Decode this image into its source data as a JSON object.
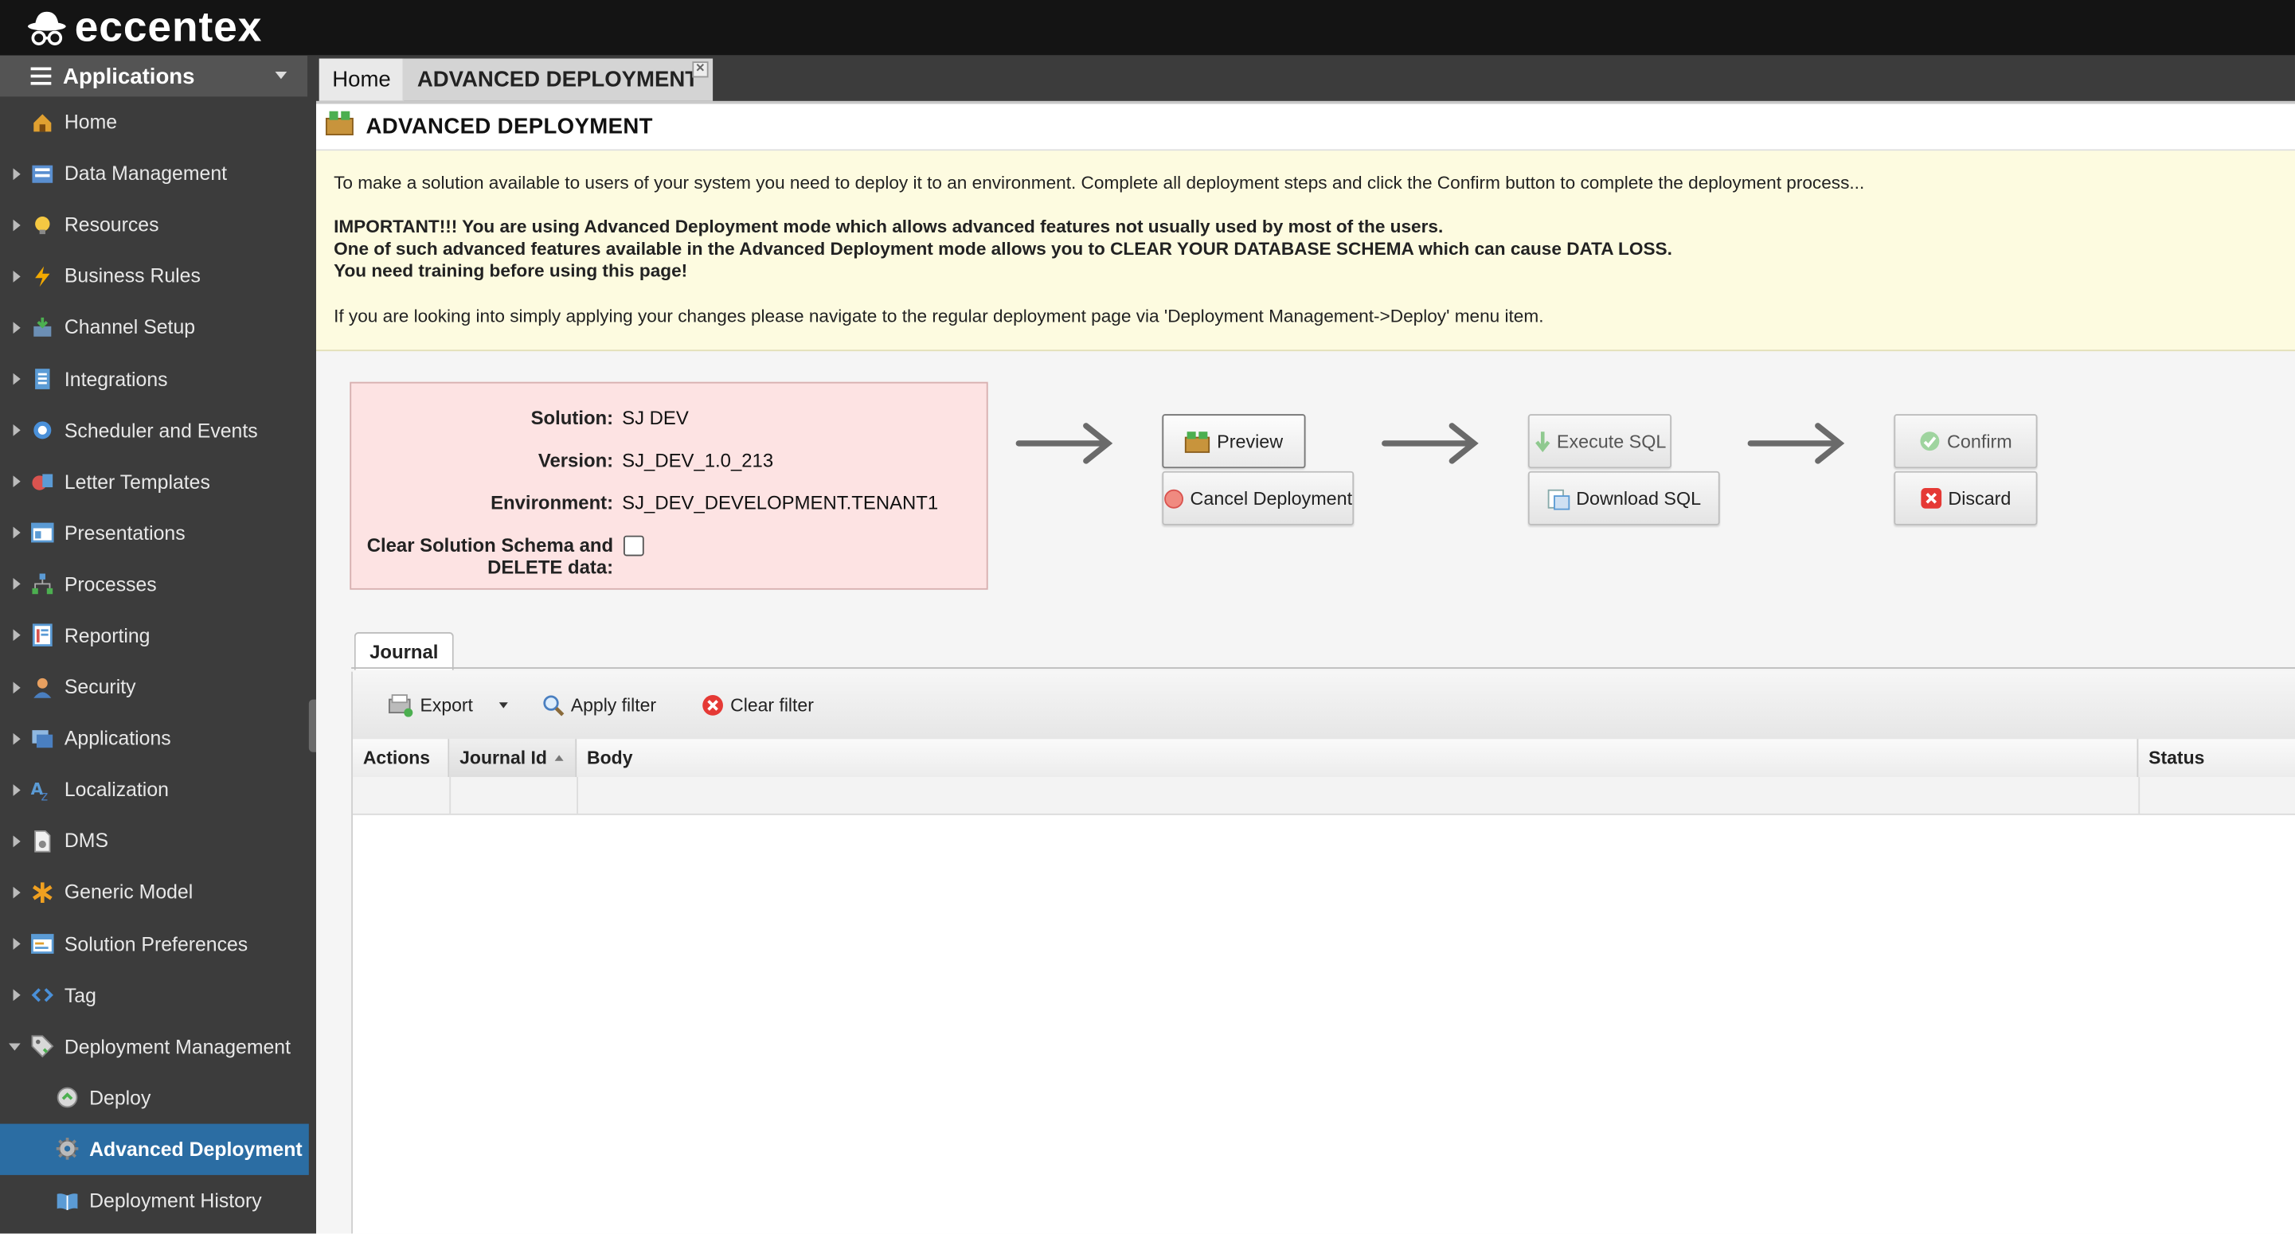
{
  "brand": {
    "name": "eccentex"
  },
  "sidebar": {
    "header_label": "Applications",
    "items": [
      {
        "label": "Home",
        "icon": "home-icon",
        "expandable": false
      },
      {
        "label": "Data Management",
        "icon": "data-management-icon",
        "expandable": true
      },
      {
        "label": "Resources",
        "icon": "lightbulb-icon",
        "expandable": true
      },
      {
        "label": "Business Rules",
        "icon": "lightning-icon",
        "expandable": true
      },
      {
        "label": "Channel Setup",
        "icon": "inbox-icon",
        "expandable": true
      },
      {
        "label": "Integrations",
        "icon": "integrations-icon",
        "expandable": true
      },
      {
        "label": "Scheduler and Events",
        "icon": "scheduler-icon",
        "expandable": true
      },
      {
        "label": "Letter Templates",
        "icon": "letter-templates-icon",
        "expandable": true
      },
      {
        "label": "Presentations",
        "icon": "presentations-icon",
        "expandable": true
      },
      {
        "label": "Processes",
        "icon": "processes-icon",
        "expandable": true
      },
      {
        "label": "Reporting",
        "icon": "reporting-icon",
        "expandable": true
      },
      {
        "label": "Security",
        "icon": "security-icon",
        "expandable": true
      },
      {
        "label": "Applications",
        "icon": "applications-icon",
        "expandable": true
      },
      {
        "label": "Localization",
        "icon": "localization-icon",
        "expandable": true
      },
      {
        "label": "DMS",
        "icon": "dms-icon",
        "expandable": true
      },
      {
        "label": "Generic Model",
        "icon": "asterisk-icon",
        "expandable": true
      },
      {
        "label": "Solution Preferences",
        "icon": "preferences-icon",
        "expandable": true
      },
      {
        "label": "Tag",
        "icon": "code-tag-icon",
        "expandable": true
      },
      {
        "label": "Deployment Management",
        "icon": "tag-icon",
        "expandable": true,
        "expanded": true
      }
    ],
    "subitems": [
      {
        "label": "Deploy",
        "icon": "deploy-icon"
      },
      {
        "label": "Advanced Deployment",
        "icon": "gear-icon",
        "active": true
      },
      {
        "label": "Deployment History",
        "icon": "book-icon"
      }
    ]
  },
  "tabs": {
    "home": "Home",
    "active": "ADVANCED DEPLOYMENT"
  },
  "page": {
    "title": "ADVANCED DEPLOYMENT"
  },
  "notice": {
    "intro": "To make a solution available to users of your system you need to deploy it to an environment. Complete all deployment steps and click the Confirm button to complete the deployment process...",
    "warning1": "IMPORTANT!!! You are using Advanced Deployment mode which allows advanced features not usually used by most of the users.",
    "warning2": "One of such advanced features available in the Advanced Deployment mode allows you to CLEAR YOUR DATABASE SCHEMA which can cause DATA LOSS.",
    "warning3": "You need training before using this page!",
    "footer": "If you are looking into simply applying your changes please navigate to the regular deployment page via 'Deployment Management->Deploy' menu item."
  },
  "params": {
    "solution_label": "Solution:",
    "solution_value": "SJ DEV",
    "version_label": "Version:",
    "version_value": "SJ_DEV_1.0_213",
    "environment_label": "Environment:",
    "environment_value": "SJ_DEV_DEVELOPMENT.TENANT1",
    "clear_label_1": "Clear Solution Schema and",
    "clear_label_2": "DELETE data:",
    "clear_checked": false
  },
  "actions": {
    "preview": "Preview",
    "cancel_deployment": "Cancel Deployment",
    "execute_sql": "Execute SQL",
    "download_sql": "Download SQL",
    "confirm": "Confirm",
    "discard": "Discard"
  },
  "journal": {
    "tab_label": "Journal",
    "toolbar": {
      "export": "Export",
      "apply_filter": "Apply filter",
      "clear_filter": "Clear filter"
    },
    "columns": [
      "Actions",
      "Journal Id",
      "Body",
      "Status"
    ]
  },
  "colors": {
    "active_menu": "#2b6da3",
    "notice_bg": "#fdfbe0",
    "params_bg": "#fde3e3",
    "topbar": "#141414"
  }
}
